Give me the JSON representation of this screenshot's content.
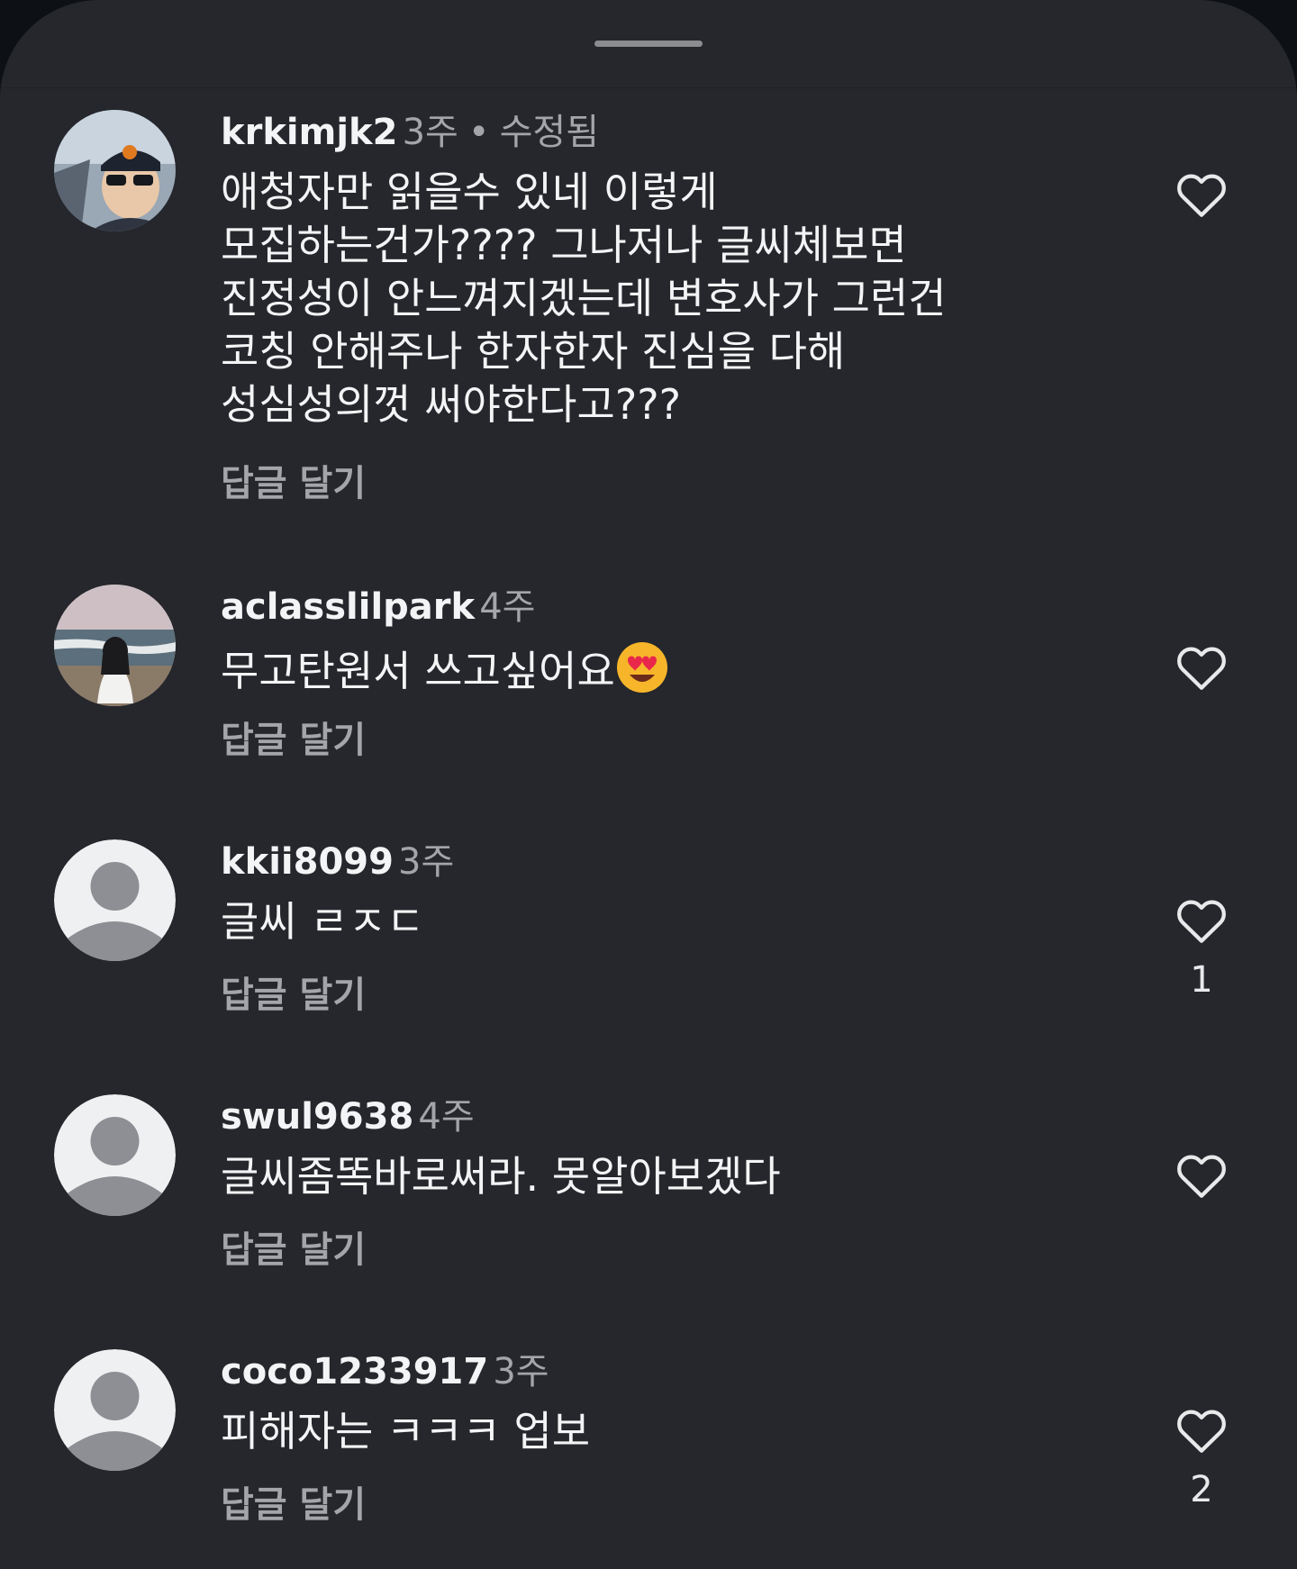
{
  "comments": [
    {
      "username": "krkimjk2",
      "time": "3주",
      "edited": "수정됨",
      "lines": [
        "애청자만 읽을수 있네 이렇게",
        "모집하는건가???? 그나저나 글씨체보면",
        "진정성이 안느껴지겠는데 변호사가 그런건",
        "코칭 안해주나 한자한자 진심을 다해",
        "성심성의껏 써야한다고???"
      ],
      "reply": "답글 달기",
      "likes": ""
    },
    {
      "username": "aclasslilpark",
      "time": "4주",
      "text": "무고탄원서 쓰고싶어요",
      "emoji": "heart-eyes-emoji",
      "reply": "답글 달기",
      "likes": ""
    },
    {
      "username": "kkii8099",
      "time": "3주",
      "text": "글씨 ㄹㅈㄷ",
      "reply": "답글 달기",
      "likes": "1"
    },
    {
      "username": "swul9638",
      "time": "4주",
      "text": "글씨좀똑바로써라. 못알아보겠다",
      "reply": "답글 달기",
      "likes": ""
    },
    {
      "username": "coco1233917",
      "time": "3주",
      "text": "피해자는 ㅋㅋㅋ 업보",
      "reply": "답글 달기",
      "likes": "2"
    }
  ],
  "icons": {
    "like": "heart-outline-icon",
    "default_avatar": "default-avatar-icon"
  },
  "colors": {
    "background": "#25272c",
    "primary_text": "#f3f4f6",
    "secondary_text": "#a3a5aa"
  }
}
